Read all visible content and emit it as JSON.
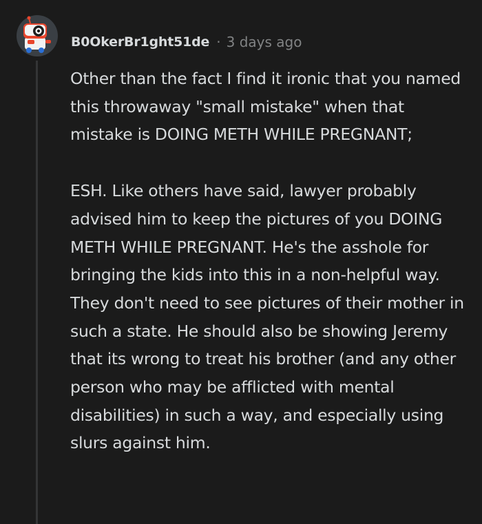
{
  "comment": {
    "author": "B0OkerBr1ght51de",
    "separator": "·",
    "timestamp": "3 days ago",
    "avatar_icon": "robot-avatar-icon",
    "paragraphs": [
      "Other than the fact I find it ironic that you named this throwaway \"small mistake\" when that mistake is DOING METH WHILE PREGNANT;",
      "ESH. Like others have said, lawyer probably advised him to keep the pictures of you DOING METH WHILE PREGNANT. He's the asshole for bringing the kids into this in a non-helpful way. They don't need to see pictures of their mother in such a state. He should also be showing Jeremy that its wrong to treat his brother (and any other person who may be afflicted with mental disabilities) in such a way, and especially using slurs against him."
    ]
  },
  "colors": {
    "background": "#1b1b1b",
    "text": "#d7dadc",
    "muted": "#818384",
    "thread_line": "#343536",
    "avatar_bg": "#3a3f44",
    "avatar_accent": "#e8452c"
  }
}
